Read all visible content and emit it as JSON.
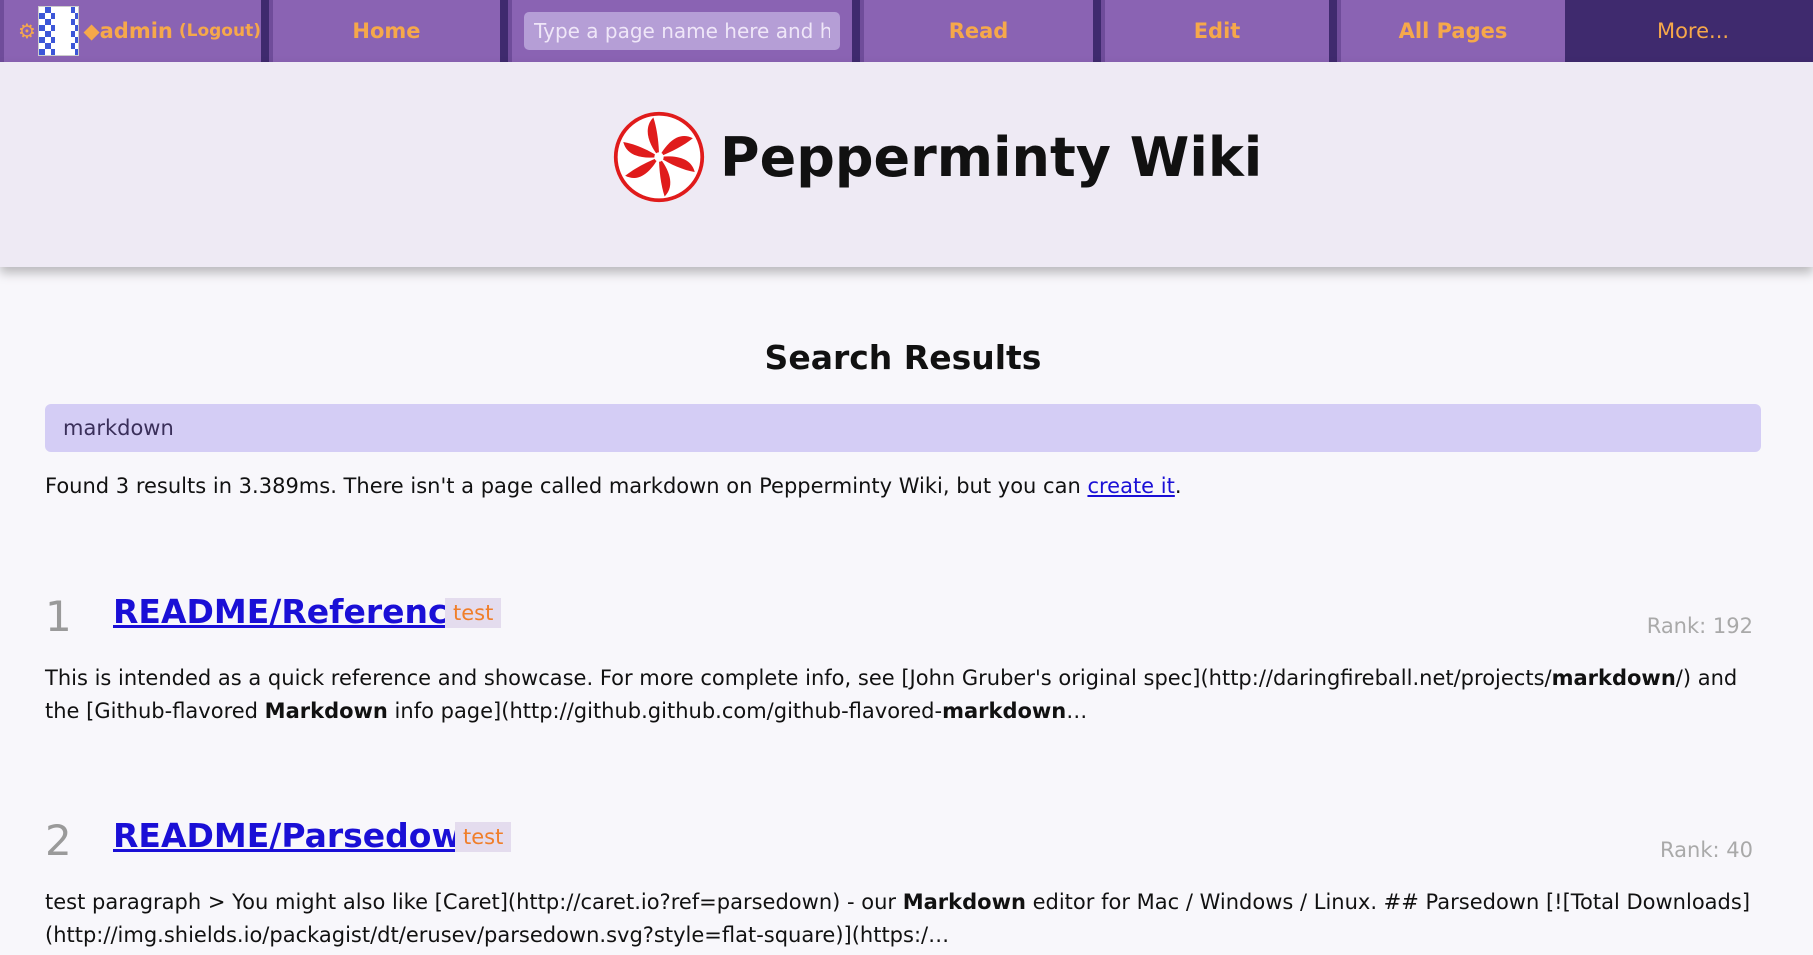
{
  "nav": {
    "gear": "⚙",
    "username": "◆admin",
    "logout": "(Logout)",
    "home": "Home",
    "search_placeholder": "Type a page name here and hit enter",
    "read": "Read",
    "edit": "Edit",
    "all_pages": "All Pages",
    "more": "More..."
  },
  "banner": {
    "site_title": "Pepperminty Wiki"
  },
  "main": {
    "title": "Search Results",
    "query": "markdown",
    "found_text": "Found 3 results in 3.389ms. There isn't a page called markdown on Pepperminty Wiki, but you can ",
    "create_link": "create it",
    "found_end": "."
  },
  "results": [
    {
      "num": "1",
      "title": "README/Reference",
      "tag": "test",
      "rank": "Rank: 192",
      "snippet_parts": [
        {
          "t": "This is intended as a quick reference and showcase. For more complete info, see [John Gruber's original spec](http://daringfireball.net/projects/",
          "b": false
        },
        {
          "t": "markdown",
          "b": true
        },
        {
          "t": "/) and the [Github-flavored ",
          "b": false
        },
        {
          "t": "Markdown",
          "b": true
        },
        {
          "t": " info page](http://github.github.com/github-flavored-",
          "b": false
        },
        {
          "t": "markdown",
          "b": true
        },
        {
          "t": "…",
          "b": false
        }
      ]
    },
    {
      "num": "2",
      "title": "README/Parsedown",
      "tag": "test",
      "rank": "Rank: 40",
      "snippet_parts": [
        {
          "t": "test paragraph > You might also like [Caret](http://caret.io?ref=parsedown) - our ",
          "b": false
        },
        {
          "t": "Markdown",
          "b": true
        },
        {
          "t": " editor for Mac / Windows / Linux. ## Parsedown [![Total Downloads](http://img.shields.io/packagist/dt/erusev/parsedown.svg?style=flat-square)](https:/…",
          "b": false
        }
      ]
    }
  ]
}
